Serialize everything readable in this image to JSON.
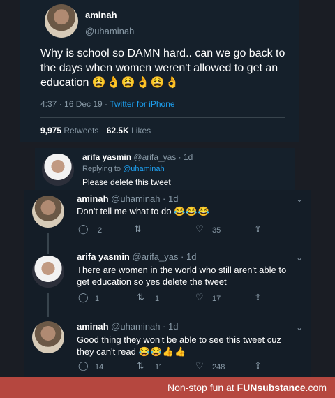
{
  "tweet": {
    "name": "aminah",
    "handle": "@uhaminah",
    "text": "Why is school so DAMN hard.. can we go back to the days when women weren't allowed to get an education",
    "emoji": "😩👌😩👌😩👌",
    "time": "4:37 · 16 Dec 19 ·",
    "source": "Twitter for iPhone",
    "retweets": "9,975",
    "retweets_label": "Retweets",
    "likes": "62.5K",
    "likes_label": "Likes"
  },
  "reply1": {
    "name": "arifa yasmin",
    "handle": "@arifa_yas · 1d",
    "replying_prefix": "Replying to",
    "replying_handle": "@uhaminah",
    "text": "Please delete this tweet"
  },
  "reply2": {
    "name": "aminah",
    "handle": "@uhaminah · 1d",
    "text": "Don't tell me what to do",
    "emoji": "😂😂😂",
    "replies": "2",
    "retweets": "",
    "likes": "35"
  },
  "reply3": {
    "name": "arifa yasmin",
    "handle": "@arifa_yas · 1d",
    "text": "There are women in the world who still aren't able to get education so yes delete the tweet",
    "replies": "1",
    "retweets": "1",
    "likes": "17"
  },
  "reply4": {
    "name": "aminah",
    "handle": "@uhaminah · 1d",
    "text": "Good thing they won't be able to see this tweet cuz they can't read",
    "emoji": "😂😂👍👍",
    "replies": "14",
    "retweets": "11",
    "likes": "248"
  },
  "footer": {
    "prefix": "Non-stop fun at",
    "brand": "FUNsubstance",
    "suffix": ".com"
  },
  "icons": [
    "reply-icon",
    "retweet-icon",
    "heart-icon",
    "share-icon",
    "chevron-down-icon"
  ]
}
